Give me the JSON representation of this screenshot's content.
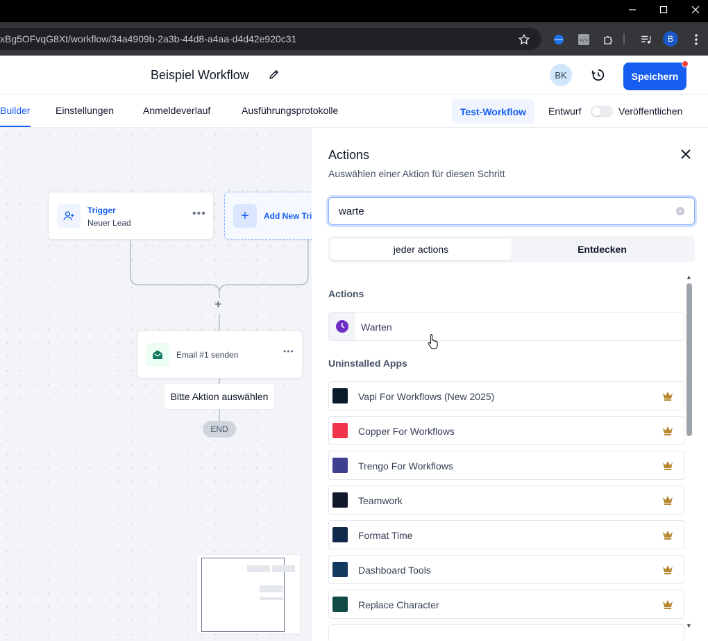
{
  "browser": {
    "url": "xBg5OFvqG8Xt/workflow/34a4909b-2a3b-44d8-a4aa-d4d42e920c31",
    "profile_initial": "B"
  },
  "header": {
    "workflow_title": "Beispiel Workflow",
    "avatar_initials": "BK",
    "save_label": "Speichern"
  },
  "tabs": {
    "items": [
      "Builder",
      "Einstellungen",
      "Anmeldeverlauf",
      "Ausführungsprotokolle"
    ],
    "active": "Builder",
    "test_label": "Test-Workflow",
    "draft_label": "Entwurf",
    "publish_label": "Veröffentlichen"
  },
  "canvas": {
    "trigger": {
      "title": "Trigger",
      "subtitle": "Neuer Lead"
    },
    "add_trigger_label": "Add New Trig",
    "email_node_label": "Email #1 senden",
    "tooltip": "Bitte Aktion auswählen",
    "end_label": "END"
  },
  "panel": {
    "title": "Actions",
    "subtitle": "Auswählen einer Aktion für diesen Schritt",
    "search_value": "warte",
    "segments": [
      "jeder actions",
      "Entdecken"
    ],
    "actions_heading": "Actions",
    "action_item": "Warten",
    "uninstalled_heading": "Uninstalled Apps",
    "apps": [
      "Vapi For Workflows (New 2025)",
      "Copper For Workflows",
      "Trengo For Workflows",
      "Teamwork",
      "Format Time",
      "Dashboard Tools",
      "Replace Character"
    ]
  },
  "colors": {
    "primary": "#155eef",
    "action_purple": "#6e2ec7",
    "crown_gold": "#b7862f",
    "email_green": "#0e7a5c"
  }
}
